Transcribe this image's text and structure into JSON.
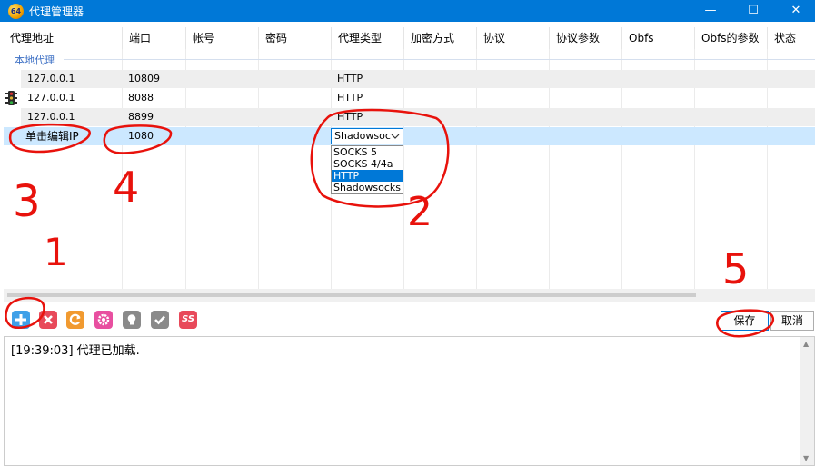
{
  "window": {
    "title": "代理管理器",
    "app_icon_label": "64",
    "minimize_glyph": "—",
    "maximize_glyph": "☐",
    "close_glyph": "✕"
  },
  "columns": [
    "代理地址",
    "端口",
    "帐号",
    "密码",
    "代理类型",
    "加密方式",
    "协议",
    "协议参数",
    "Obfs",
    "Obfs的参数",
    "状态"
  ],
  "group_label": "本地代理",
  "rows": [
    {
      "address": "127.0.0.1",
      "port": "10809",
      "type": "HTTP"
    },
    {
      "address": "127.0.0.1",
      "port": "8088",
      "type": "HTTP"
    },
    {
      "address": "127.0.0.1",
      "port": "8899",
      "type": "HTTP"
    }
  ],
  "edit_row": {
    "address_placeholder": "单击编辑IP",
    "port": "1080",
    "type_value": "Shadowsocks"
  },
  "type_options": [
    "SOCKS 5",
    "SOCKS 4/4a",
    "HTTP",
    "Shadowsocks"
  ],
  "type_options_highlighted": "HTTP",
  "toolbar": {
    "icons": [
      "add-icon",
      "delete-icon",
      "refresh-icon",
      "settings-icon",
      "bulb-icon",
      "check-icon",
      "ss-icon"
    ],
    "ss_label": "SS",
    "save_label": "保存",
    "cancel_label": "取消"
  },
  "log": {
    "lines": [
      "[19:39:03]  代理已加载."
    ]
  },
  "annotations": [
    "1",
    "2",
    "3",
    "4",
    "5"
  ],
  "colors": {
    "titlebar": "#0078d7",
    "selection": "#cce8ff",
    "annotation": "#e8120c",
    "group": "#3c6fc4"
  }
}
